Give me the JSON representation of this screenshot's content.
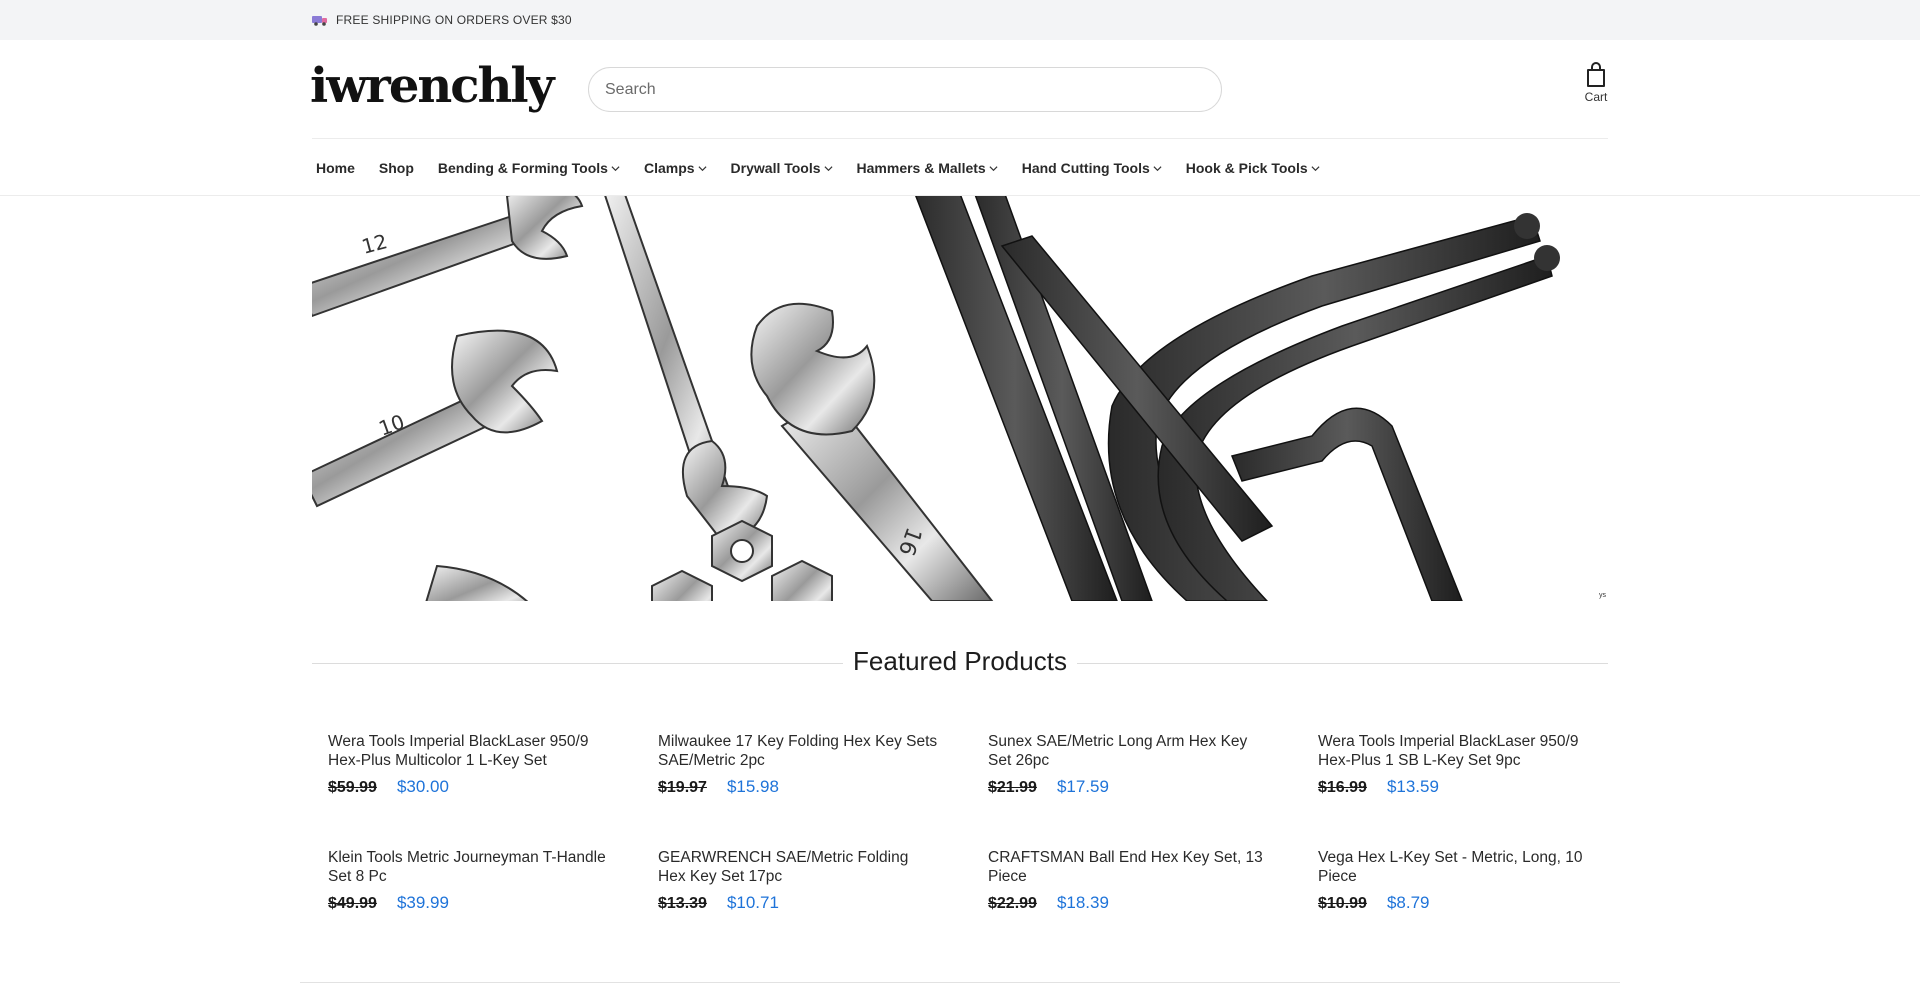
{
  "announcement": {
    "icon": "truck-icon",
    "text": "FREE SHIPPING ON ORDERS OVER $30"
  },
  "header": {
    "logo": "iwrenchly",
    "search": {
      "placeholder": "Search",
      "value": ""
    },
    "cart": {
      "icon": "shopping-bag-icon",
      "label": "Cart"
    }
  },
  "nav": {
    "items": [
      {
        "label": "Home",
        "dropdown": false
      },
      {
        "label": "Shop",
        "dropdown": false
      },
      {
        "label": "Bending & Forming Tools",
        "dropdown": true
      },
      {
        "label": "Clamps",
        "dropdown": true
      },
      {
        "label": "Drywall Tools",
        "dropdown": true
      },
      {
        "label": "Hammers & Mallets",
        "dropdown": true
      },
      {
        "label": "Hand Cutting Tools",
        "dropdown": true
      },
      {
        "label": "Hook & Pick Tools",
        "dropdown": true
      }
    ]
  },
  "hero": {
    "image": "wrenches-and-hex-keys-photo",
    "wrench_labels": [
      "12",
      "10",
      "16"
    ],
    "corner_mark": "ys"
  },
  "featured": {
    "title": "Featured Products",
    "products": [
      {
        "title": "Wera Tools Imperial BlackLaser 950/9 Hex-Plus Multicolor 1 L-Key Set",
        "old_price": "$59.99",
        "price": "$30.00"
      },
      {
        "title": "Milwaukee 17 Key Folding Hex Key Sets SAE/Metric 2pc",
        "old_price": "$19.97",
        "price": "$15.98"
      },
      {
        "title": "Sunex SAE/Metric Long Arm Hex Key Set 26pc",
        "old_price": "$21.99",
        "price": "$17.59"
      },
      {
        "title": "Wera Tools Imperial BlackLaser 950/9 Hex-Plus 1 SB L-Key Set 9pc",
        "old_price": "$16.99",
        "price": "$13.59"
      },
      {
        "title": "Klein Tools Metric Journeyman T-Handle Set 8 Pc",
        "old_price": "$49.99",
        "price": "$39.99"
      },
      {
        "title": "GEARWRENCH SAE/Metric Folding Hex Key Set 17pc",
        "old_price": "$13.39",
        "price": "$10.71"
      },
      {
        "title": "CRAFTSMAN Ball End Hex Key Set, 13 Piece",
        "old_price": "$22.99",
        "price": "$18.39"
      },
      {
        "title": "Vega Hex L-Key Set - Metric, Long, 10 Piece",
        "old_price": "$10.99",
        "price": "$8.79"
      }
    ]
  },
  "colors": {
    "sale_price": "#1e73d9",
    "announcement_bg": "#f3f4f6"
  }
}
